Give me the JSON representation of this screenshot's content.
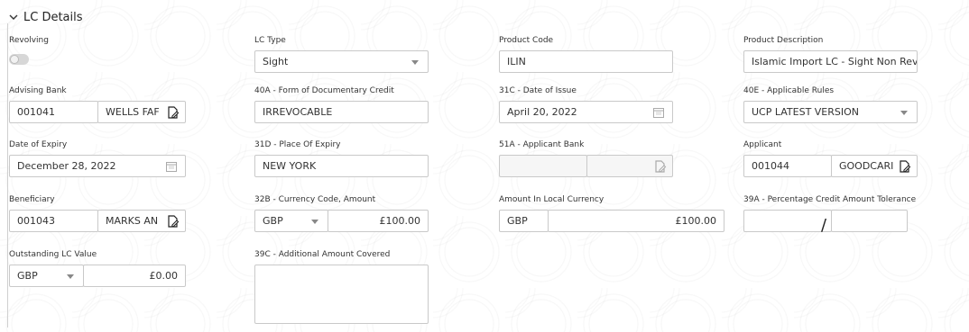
{
  "section": {
    "title": "LC Details"
  },
  "fields": {
    "revolving": {
      "label": "Revolving"
    },
    "lc_type": {
      "label": "LC Type",
      "value": "Sight"
    },
    "product_code": {
      "label": "Product Code",
      "value": "ILIN"
    },
    "product_description": {
      "label": "Product Description",
      "value": "Islamic Import LC - Sight Non Revolv"
    },
    "advising_bank": {
      "label": "Advising Bank",
      "code": "001041",
      "name": "WELLS FAF"
    },
    "form_of_credit": {
      "label": "40A - Form of Documentary Credit",
      "value": "IRREVOCABLE"
    },
    "date_of_issue": {
      "label": "31C - Date of Issue",
      "value": "April 20, 2022"
    },
    "applicable_rules": {
      "label": "40E - Applicable Rules",
      "value": "UCP LATEST VERSION"
    },
    "date_of_expiry": {
      "label": "Date of Expiry",
      "value": "December 28, 2022"
    },
    "place_of_expiry": {
      "label": "31D - Place Of Expiry",
      "value": "NEW YORK"
    },
    "applicant_bank": {
      "label": "51A - Applicant Bank",
      "code": "",
      "name": ""
    },
    "applicant": {
      "label": "Applicant",
      "code": "001044",
      "name": "GOODCARI"
    },
    "beneficiary": {
      "label": "Beneficiary",
      "code": "001043",
      "name": "MARKS AN"
    },
    "currency_amount": {
      "label": "32B - Currency Code, Amount",
      "currency": "GBP",
      "amount": "£100.00"
    },
    "amount_local": {
      "label": "Amount In Local Currency",
      "currency": "GBP",
      "amount": "£100.00"
    },
    "tolerance": {
      "label": "39A - Percentage Credit Amount Tolerance",
      "separator": "/"
    },
    "outstanding": {
      "label": "Outstanding LC Value",
      "currency": "GBP",
      "amount": "£0.00"
    },
    "additional_amount": {
      "label": "39C - Additional Amount Covered",
      "value": ""
    }
  }
}
